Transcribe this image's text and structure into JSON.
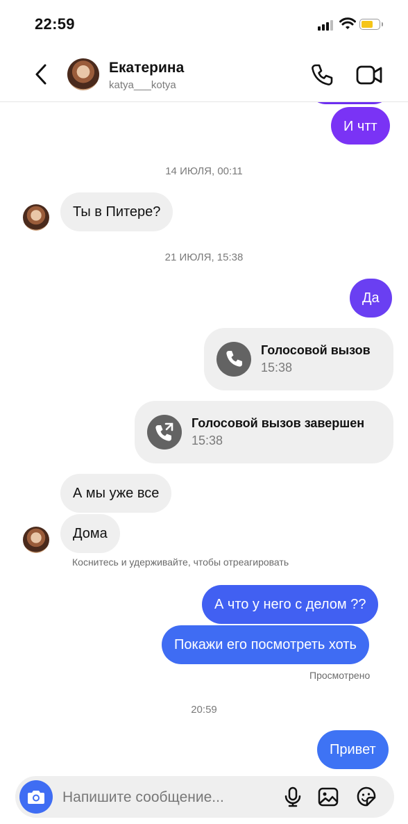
{
  "status_bar": {
    "time": "22:59"
  },
  "header": {
    "name": "Екатерина",
    "username": "katya___kotya",
    "icons": [
      "back-chevron-icon",
      "phone-icon",
      "video-camera-icon"
    ]
  },
  "messages": {
    "m1": "И чтт",
    "stamp1": "14 ИЮЛЯ, 00:11",
    "m2": "Ты в Питере?",
    "stamp2": "21 ИЮЛЯ, 15:38",
    "m3": "Да",
    "call1": {
      "title": "Голосовой вызов",
      "time": "15:38"
    },
    "call2": {
      "title": "Голосовой вызов завершен",
      "time": "15:38"
    },
    "m4": "А мы уже все",
    "m5": "Дома",
    "hint": "Коснитесь и удерживайте, чтобы отреагировать",
    "m6": "А что у него с делом ??",
    "m7": "Покажи его посмотреть хоть",
    "seen": "Просмотрено",
    "stamp3": "20:59",
    "m8": "Привет"
  },
  "composer": {
    "placeholder": "Напишите сообщение...",
    "icons": [
      "camera-icon",
      "microphone-icon",
      "gallery-icon",
      "sticker-icon"
    ]
  },
  "colors": {
    "purple_bubble": "#7a33f5",
    "blue_bubble": "#3f6df3",
    "incoming_bubble": "#efefef",
    "battery": "#f5c518"
  }
}
